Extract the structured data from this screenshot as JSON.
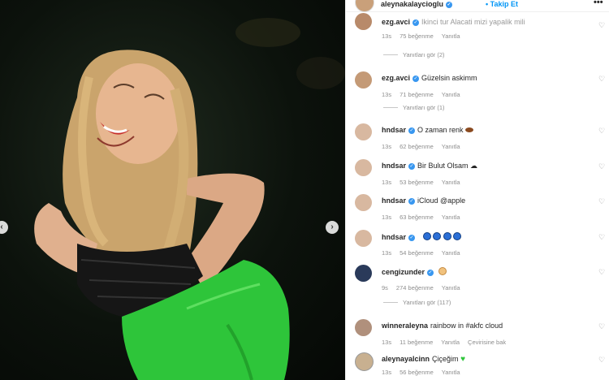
{
  "header": {
    "username": "aleynakalaycioglu",
    "follow_label": "Takip Et",
    "more_label": "•••"
  },
  "photo": {
    "nav_left": "‹",
    "nav_right": "›"
  },
  "comments": [
    {
      "user": "ezg.avci",
      "text": "Ikinci tur Alacati mizi yapalik mili",
      "time": "13s",
      "likes": "75 beğenme",
      "reply": "Yanıtla",
      "extra": "",
      "verified": true
    },
    {
      "user": "ezg.avci",
      "text": "Güzelsin askimm",
      "time": "13s",
      "likes": "71 beğenme",
      "reply": "Yanıtla",
      "extra": "",
      "verified": true
    },
    {
      "user": "hndsar",
      "text": "O zaman renk",
      "time": "13s",
      "likes": "62 beğenme",
      "reply": "Yanıtla",
      "extra": "",
      "verified": true
    },
    {
      "user": "hndsar",
      "text": "Bir Bulut Olsam ☁",
      "time": "13s",
      "likes": "53 beğenme",
      "reply": "Yanıtla",
      "extra": "",
      "verified": true
    },
    {
      "user": "hndsar",
      "text": "iCloud @apple",
      "time": "13s",
      "likes": "63 beğenme",
      "reply": "Yanıtla",
      "extra": "",
      "verified": true
    },
    {
      "user": "hndsar",
      "text": "",
      "time": "13s",
      "likes": "54 beğenme",
      "reply": "Yanıtla",
      "extra": "",
      "verified": true
    },
    {
      "user": "cengizunder",
      "text": "",
      "time": "9s",
      "likes": "274 beğenme",
      "reply": "Yanıtla",
      "extra": "",
      "verified": true
    },
    {
      "user": "winneraleyna",
      "text": "rainbow in #akfc cloud",
      "time": "13s",
      "likes": "11 beğenme",
      "reply": "Yanıtla",
      "extra": "Çevirisine bak",
      "verified": false
    },
    {
      "user": "aleynayalcinn",
      "text": "Çiçeğim",
      "time": "13s",
      "likes": "56 beğenme",
      "reply": "Yanıtla",
      "extra": "",
      "verified": false
    }
  ],
  "reply_links": [
    {
      "label": "Yanıtları gör (2)"
    },
    {
      "label": "Yanıtları gör (1)"
    },
    {
      "label": "Yanıtları gör (117)"
    }
  ],
  "colors": {
    "link_blue": "#0095f6",
    "verified_blue": "#3897f0",
    "outfit_green": "#2ec53a"
  },
  "icons": {
    "heart": "♡",
    "verified": "✓"
  }
}
